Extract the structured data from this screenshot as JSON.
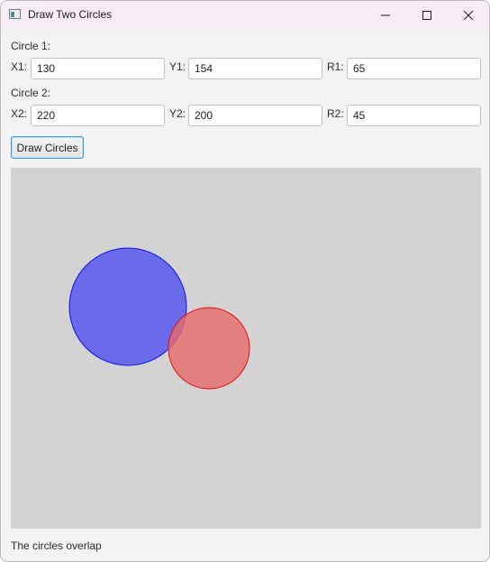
{
  "window": {
    "title": "Draw Two Circles"
  },
  "circle1": {
    "heading": "Circle 1:",
    "x_label": "X1:",
    "x_value": "130",
    "y_label": "Y1:",
    "y_value": "154",
    "r_label": "R1:",
    "r_value": "65",
    "fill": "#6a6aea",
    "stroke": "#1010e0"
  },
  "circle2": {
    "heading": "Circle 2:",
    "x_label": "X2:",
    "x_value": "220",
    "y_label": "Y2:",
    "y_value": "200",
    "r_label": "R2:",
    "r_value": "45",
    "fill": "#e86a6a",
    "stroke": "#e01010"
  },
  "actions": {
    "draw_label": "Draw Circles"
  },
  "status": {
    "text": "The circles overlap"
  },
  "icons": [
    "app-icon",
    "minimize-icon",
    "maximize-icon",
    "close-icon"
  ]
}
